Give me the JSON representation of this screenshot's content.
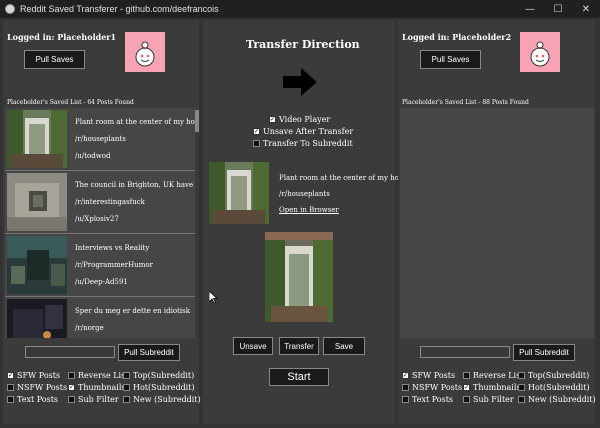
{
  "window": {
    "title": "Reddit Saved Transferer - github.com/deefrancois",
    "controls": {
      "minimize": "—",
      "maximize": "☐",
      "close": "✕"
    }
  },
  "left": {
    "login": "Logged in: Placeholder1",
    "pull_saves": "Pull Saves",
    "saved_label": "Placeholder's Saved List - 64 Posts Found",
    "posts": [
      {
        "title": "Plant room at the center of my ho",
        "subreddit": "/r/houseplants",
        "user": "/u/todwod"
      },
      {
        "title": "The council in Brighton, UK have",
        "subreddit": "/r/interestingasfuck",
        "user": "/u/Xplosiv27"
      },
      {
        "title": "Interviews vs Reality",
        "subreddit": "/r/ProgrammerHumor",
        "user": "/u/Deep-Ad591"
      },
      {
        "title": "Sper du meg er dette en idiotisk",
        "subreddit": "/r/norge",
        "user": ""
      }
    ],
    "pull_subreddit": "Pull Subreddit",
    "checks": [
      {
        "label": "SFW Posts",
        "checked": true
      },
      {
        "label": "Reverse List",
        "checked": false
      },
      {
        "label": "Top(Subreddit)",
        "checked": false
      },
      {
        "label": "NSFW Posts",
        "checked": false
      },
      {
        "label": "Thumbnails",
        "checked": true
      },
      {
        "label": "Hot(Subreddit)",
        "checked": false
      },
      {
        "label": "Text Posts",
        "checked": false
      },
      {
        "label": "Sub Filter",
        "checked": false
      },
      {
        "label": "New (Subreddit)",
        "checked": false
      }
    ]
  },
  "center": {
    "heading": "Transfer Direction",
    "options": [
      {
        "label": "Video Player",
        "checked": true
      },
      {
        "label": "Unsave After Transfer",
        "checked": true
      },
      {
        "label": "Transfer To Subreddit",
        "checked": false
      }
    ],
    "preview": {
      "title": "Plant room at the center of my ho",
      "subreddit": "/r/houseplants",
      "link": "Open in Browser"
    },
    "buttons": {
      "unsave": "Unsave",
      "transfer": "Transfer",
      "save": "Save",
      "start": "Start"
    }
  },
  "right": {
    "login": "Logged in: Placeholder2",
    "pull_saves": "Pull Saves",
    "saved_label": "Placeholder's Saved List - 88 Posts Found",
    "pull_subreddit": "Pull Subreddit",
    "checks": [
      {
        "label": "SFW Posts",
        "checked": true
      },
      {
        "label": "Reverse List",
        "checked": false
      },
      {
        "label": "Top(Subreddit)",
        "checked": false
      },
      {
        "label": "NSFW Posts",
        "checked": false
      },
      {
        "label": "Thumbnails",
        "checked": true
      },
      {
        "label": "Hot(Subreddit)",
        "checked": false
      },
      {
        "label": "Text Posts",
        "checked": false
      },
      {
        "label": "Sub Filter",
        "checked": false
      },
      {
        "label": "New (Subreddit)",
        "checked": false
      }
    ]
  },
  "colors": {
    "avatar_bg": "#f7a3b5",
    "panel": "#3b3b3b",
    "background": "#333333"
  }
}
